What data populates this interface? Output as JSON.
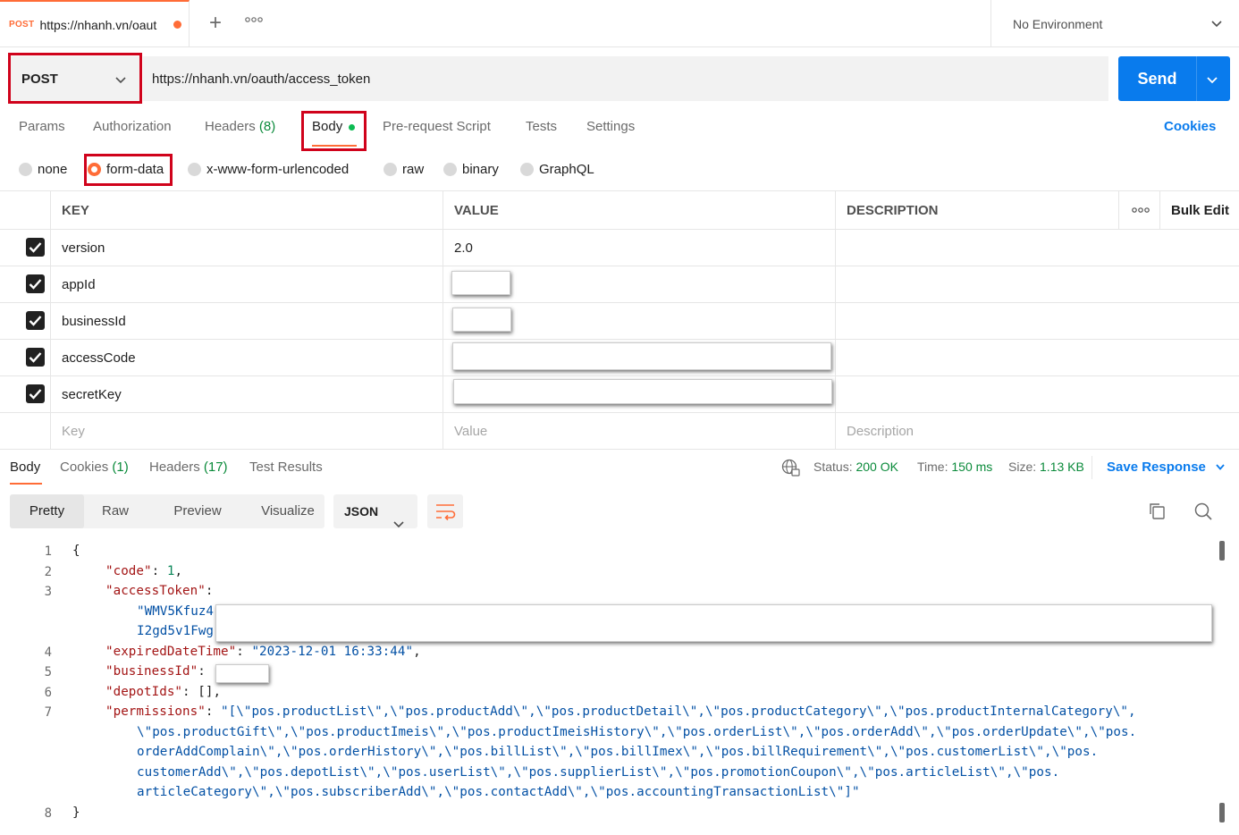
{
  "tab": {
    "method": "POST",
    "url": "https://nhanh.vn/oaut"
  },
  "environment": {
    "label": "No Environment"
  },
  "request": {
    "method": "POST",
    "url": "https://nhanh.vn/oauth/access_token",
    "send_label": "Send"
  },
  "request_tabs": {
    "params": "Params",
    "authorization": "Authorization",
    "headers": "Headers",
    "headers_count": "(8)",
    "body": "Body",
    "prerequest": "Pre-request Script",
    "tests": "Tests",
    "settings": "Settings",
    "cookies": "Cookies"
  },
  "body_modes": {
    "none": "none",
    "form_data": "form-data",
    "urlencoded": "x-www-form-urlencoded",
    "raw": "raw",
    "binary": "binary",
    "graphql": "GraphQL",
    "selected": "form-data"
  },
  "params_table": {
    "headers": {
      "key": "KEY",
      "value": "VALUE",
      "description": "DESCRIPTION",
      "bulk_edit": "Bulk Edit"
    },
    "rows": [
      {
        "key": "version",
        "value": "2.0",
        "checked": true
      },
      {
        "key": "appId",
        "value": "",
        "checked": true
      },
      {
        "key": "businessId",
        "value": "",
        "checked": true
      },
      {
        "key": "accessCode",
        "value": "",
        "checked": true
      },
      {
        "key": "secretKey",
        "value": "",
        "checked": true
      }
    ],
    "placeholders": {
      "key": "Key",
      "value": "Value",
      "description": "Description"
    }
  },
  "response_tabs": {
    "body": "Body",
    "cookies": "Cookies",
    "cookies_count": "(1)",
    "headers": "Headers",
    "headers_count": "(17)",
    "test_results": "Test Results"
  },
  "status": {
    "status_label": "Status:",
    "status_value": "200 OK",
    "time_label": "Time:",
    "time_value": "150 ms",
    "size_label": "Size:",
    "size_value": "1.13 KB",
    "save_response": "Save Response"
  },
  "view": {
    "pretty": "Pretty",
    "raw": "Raw",
    "preview": "Preview",
    "visualize": "Visualize",
    "format": "JSON"
  },
  "code": {
    "line_numbers": [
      "1",
      "2",
      "3",
      "4",
      "5",
      "6",
      "7",
      "8"
    ],
    "open_brace": "{",
    "close_brace": "}",
    "code_key": "\"code\"",
    "code_val": "1",
    "access_key": "\"accessToken\"",
    "access_val_1": "\"WMV5Kfuz4",
    "access_val_2": "I2gd5v1Fwg",
    "expired_key": "\"expiredDateTime\"",
    "expired_val": "\"2023-12-01 16:33:44\"",
    "business_key": "\"businessId\"",
    "depot_key": "\"depotIds\"",
    "depot_val": "[]",
    "perm_key": "\"permissions\"",
    "perm_line_1": "\"[\\\"pos.productList\\\",\\\"pos.productAdd\\\",\\\"pos.productDetail\\\",\\\"pos.productCategory\\\",\\\"pos.productInternalCategory\\\",",
    "perm_line_2": "\\\"pos.productGift\\\",\\\"pos.productImeis\\\",\\\"pos.productImeisHistory\\\",\\\"pos.orderList\\\",\\\"pos.orderAdd\\\",\\\"pos.orderUpdate\\\",\\\"pos.",
    "perm_line_3": "orderAddComplain\\\",\\\"pos.orderHistory\\\",\\\"pos.billList\\\",\\\"pos.billImex\\\",\\\"pos.billRequirement\\\",\\\"pos.customerList\\\",\\\"pos.",
    "perm_line_4": "customerAdd\\\",\\\"pos.depotList\\\",\\\"pos.userList\\\",\\\"pos.supplierList\\\",\\\"pos.promotionCoupon\\\",\\\"pos.articleList\\\",\\\"pos.",
    "perm_line_5": "articleCategory\\\",\\\"pos.subscriberAdd\\\",\\\"pos.contactAdd\\\",\\\"pos.accountingTransactionList\\\"]\""
  },
  "colors": {
    "accent": "#ff6c37",
    "send": "#097bed",
    "ok": "#0a8a3a",
    "highlight_box": "#d0021b"
  }
}
